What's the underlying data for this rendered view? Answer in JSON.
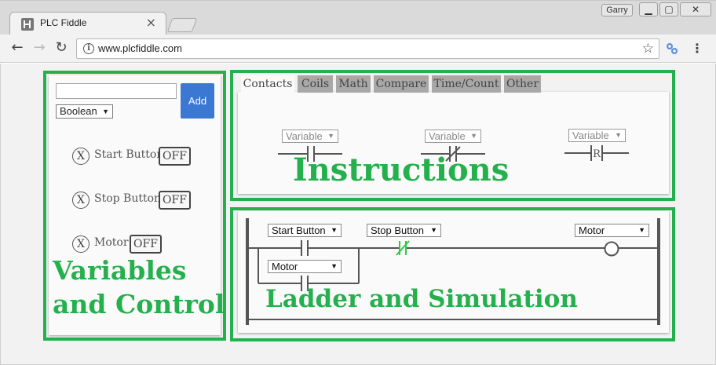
{
  "browser": {
    "tab_title": "PLC Fiddle",
    "tab_close": "×",
    "user_label": "Garry",
    "url": "www.plcfiddle.com",
    "back_glyph": "←",
    "forward_glyph": "→",
    "reload_glyph": "↻",
    "info_glyph": "i",
    "star_glyph": "☆",
    "menu_glyph": "⋮",
    "minimize_glyph": "▁",
    "maximize_glyph": "▢",
    "close_glyph": "✕"
  },
  "variables_panel": {
    "name_input_value": "",
    "type_select_value": "Boolean",
    "add_label": "Add",
    "variables": [
      {
        "name": "Start Button",
        "state": "OFF",
        "x_glyph": "X"
      },
      {
        "name": "Stop Button",
        "state": "OFF",
        "x_glyph": "X"
      },
      {
        "name": "Motor",
        "state": "OFF",
        "x_glyph": "X"
      }
    ],
    "overlay_line1": "Variables",
    "overlay_line2": "and Control"
  },
  "instructions_panel": {
    "tabs": [
      "Contacts",
      "Coils",
      "Math",
      "Compare",
      "Time/Count",
      "Other"
    ],
    "active_tab": "Contacts",
    "contacts": [
      {
        "type": "normally-open",
        "variable_placeholder": "Variable"
      },
      {
        "type": "normally-closed",
        "variable_placeholder": "Variable"
      },
      {
        "type": "rising-edge",
        "variable_placeholder": "Variable",
        "symbol": "R"
      }
    ],
    "overlay_label": "Instructions"
  },
  "ladder_panel": {
    "rung": {
      "branch_top": {
        "variable": "Start Button",
        "contact": "normally-open"
      },
      "branch_bottom": {
        "variable": "Motor",
        "contact": "normally-open"
      },
      "series": {
        "variable": "Stop Button",
        "contact": "normally-closed",
        "energized": true
      },
      "coil": {
        "variable": "Motor"
      }
    },
    "overlay_label": "Ladder and Simulation"
  },
  "colors": {
    "highlight_green": "#24b04c",
    "add_button_blue": "#3b78d4",
    "energized_green": "#2ecc40"
  }
}
